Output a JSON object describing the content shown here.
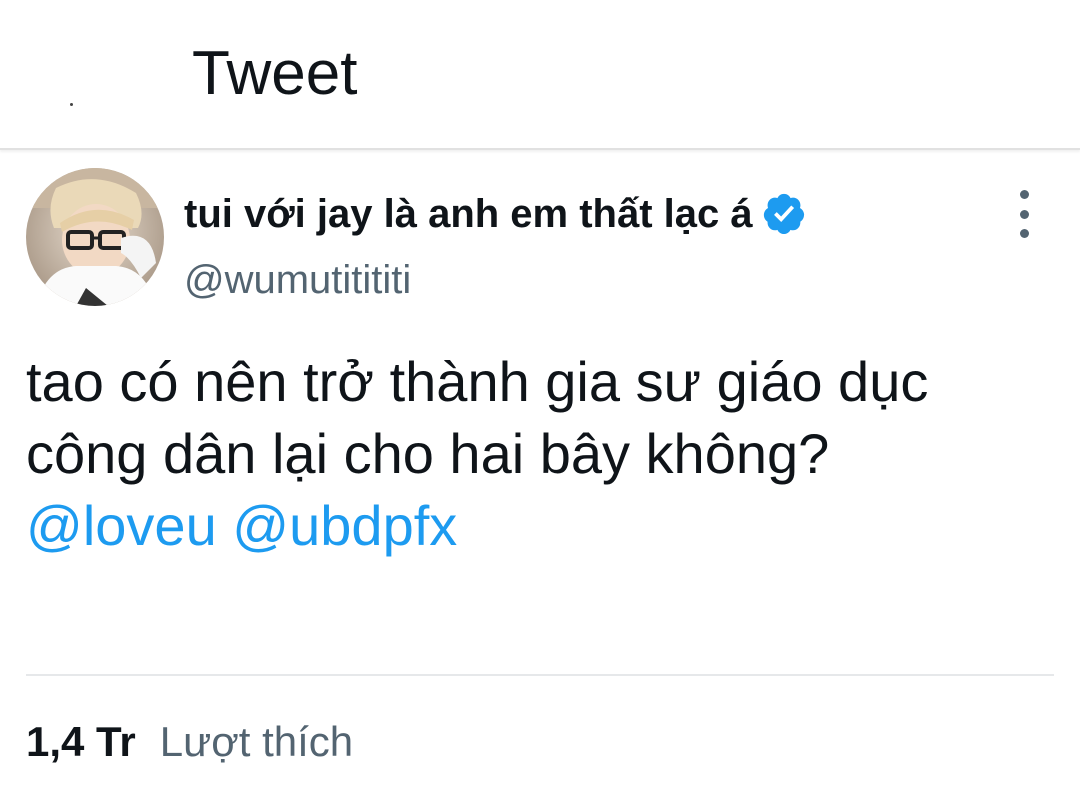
{
  "header": {
    "title": "Tweet",
    "back_icon": "back-arrow-icon"
  },
  "tweet": {
    "author": {
      "display_name": "tui với jay là anh em thất lạc á",
      "handle": "@wumutitititi",
      "verified": true,
      "verified_color": "#1d9bf0"
    },
    "text_lines": [
      "tao có nên trở thành gia sư giáo dục",
      "công dân lại cho hai bây không?"
    ],
    "mentions": [
      "@loveu",
      "@ubdpfx"
    ],
    "mention_color": "#1d9bf0"
  },
  "stats": {
    "likes_count": "1,4 Tr",
    "likes_label": "Lượt thích"
  }
}
